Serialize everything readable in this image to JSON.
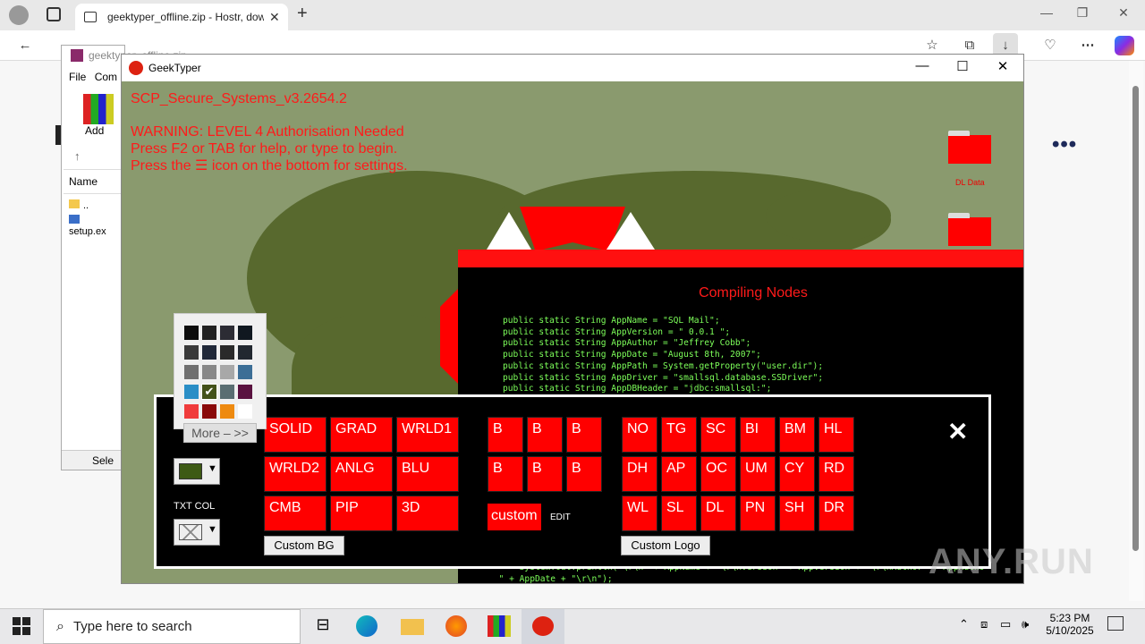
{
  "browser": {
    "tab_title": "geektyper_offline.zip - Hostr, dow",
    "close_tab": "✕",
    "new_tab": "+",
    "window_min": "—",
    "window_max": "❐",
    "window_close": "✕",
    "more_menu": "•••"
  },
  "winrar": {
    "title": "geektyper_offline.zip",
    "menu_file": "File",
    "menu_commands": "Com",
    "add_label": "Add",
    "col_name": "Name",
    "items": [
      "..",
      "setup.ex"
    ],
    "status": "Sele"
  },
  "geektyper": {
    "title": "GeekTyper",
    "min": "—",
    "max": "☐",
    "close": "✕",
    "system_name": "SCP_Secure_Systems_v3.2654.2",
    "warning_lines": [
      "WARNING: LEVEL 4 Authorisation Needed",
      "Press F2 or TAB for help, or type to begin.",
      "Press the ☰ icon on the bottom for settings."
    ],
    "folder1_label": "DL Data",
    "code_title": "Compiling Nodes",
    "code": "public static String AppName = \"SQL Mail\";\npublic static String AppVersion = \" 0.0.1 \";\npublic static String AppAuthor = \"Jeffrey Cobb\";\npublic static String AppDate = \"August 8th, 2007\";\npublic static String AppPath = System.getProperty(\"user.dir\");\npublic static String AppDriver = \"smallsql.database.SSDriver\";\npublic static String AppDBHeader = \"jdbc:smallsql:\";",
    "code_tail": "      System.out.println( \\r\\n  + AppName +  \\r\\nVersion  + AppVersion +  \\r\\nAuthor  + AppAutho\n  \" + AppDate + \"\\r\\n\");"
  },
  "settings": {
    "bg_buttons": [
      "SOLID",
      "GRAD",
      "WRLD1",
      "WRLD2",
      "ANLG",
      "BLU",
      "CMB",
      "PIP",
      "3D"
    ],
    "b_buttons": [
      "B",
      "B",
      "B",
      "B",
      "B",
      "B"
    ],
    "custom_label": "custom",
    "edit_label": "EDIT",
    "logo_buttons": [
      "NO",
      "TG",
      "SC",
      "BI",
      "BM",
      "HL",
      "DH",
      "AP",
      "OC",
      "UM",
      "CY",
      "RD",
      "WL",
      "SL",
      "DL",
      "PN",
      "SH",
      "DR"
    ],
    "custom_bg": "Custom BG",
    "custom_logo": "Custom Logo",
    "txt_col": "TXT COL",
    "more": "More – >>",
    "close": "✕",
    "swatches": [
      "#0d0d0d",
      "#222222",
      "#2c2c34",
      "#101820",
      "#3a3a3a",
      "#202838",
      "#2a2a2a",
      "#222830",
      "#707070",
      "#888888",
      "#a8a8a8",
      "#3c6e96",
      "#2a8ec6",
      "#44521a",
      "#5a6e72",
      "#5a1240",
      "#f03c3c",
      "#8a0a0a",
      "#ee8a10",
      "#ffffff"
    ],
    "selected_color": "#3d5a14"
  },
  "taskbar": {
    "search_placeholder": "Type here to search",
    "time": "5:23 PM",
    "date": "5/10/2025"
  },
  "watermark": "ANY.RUN"
}
